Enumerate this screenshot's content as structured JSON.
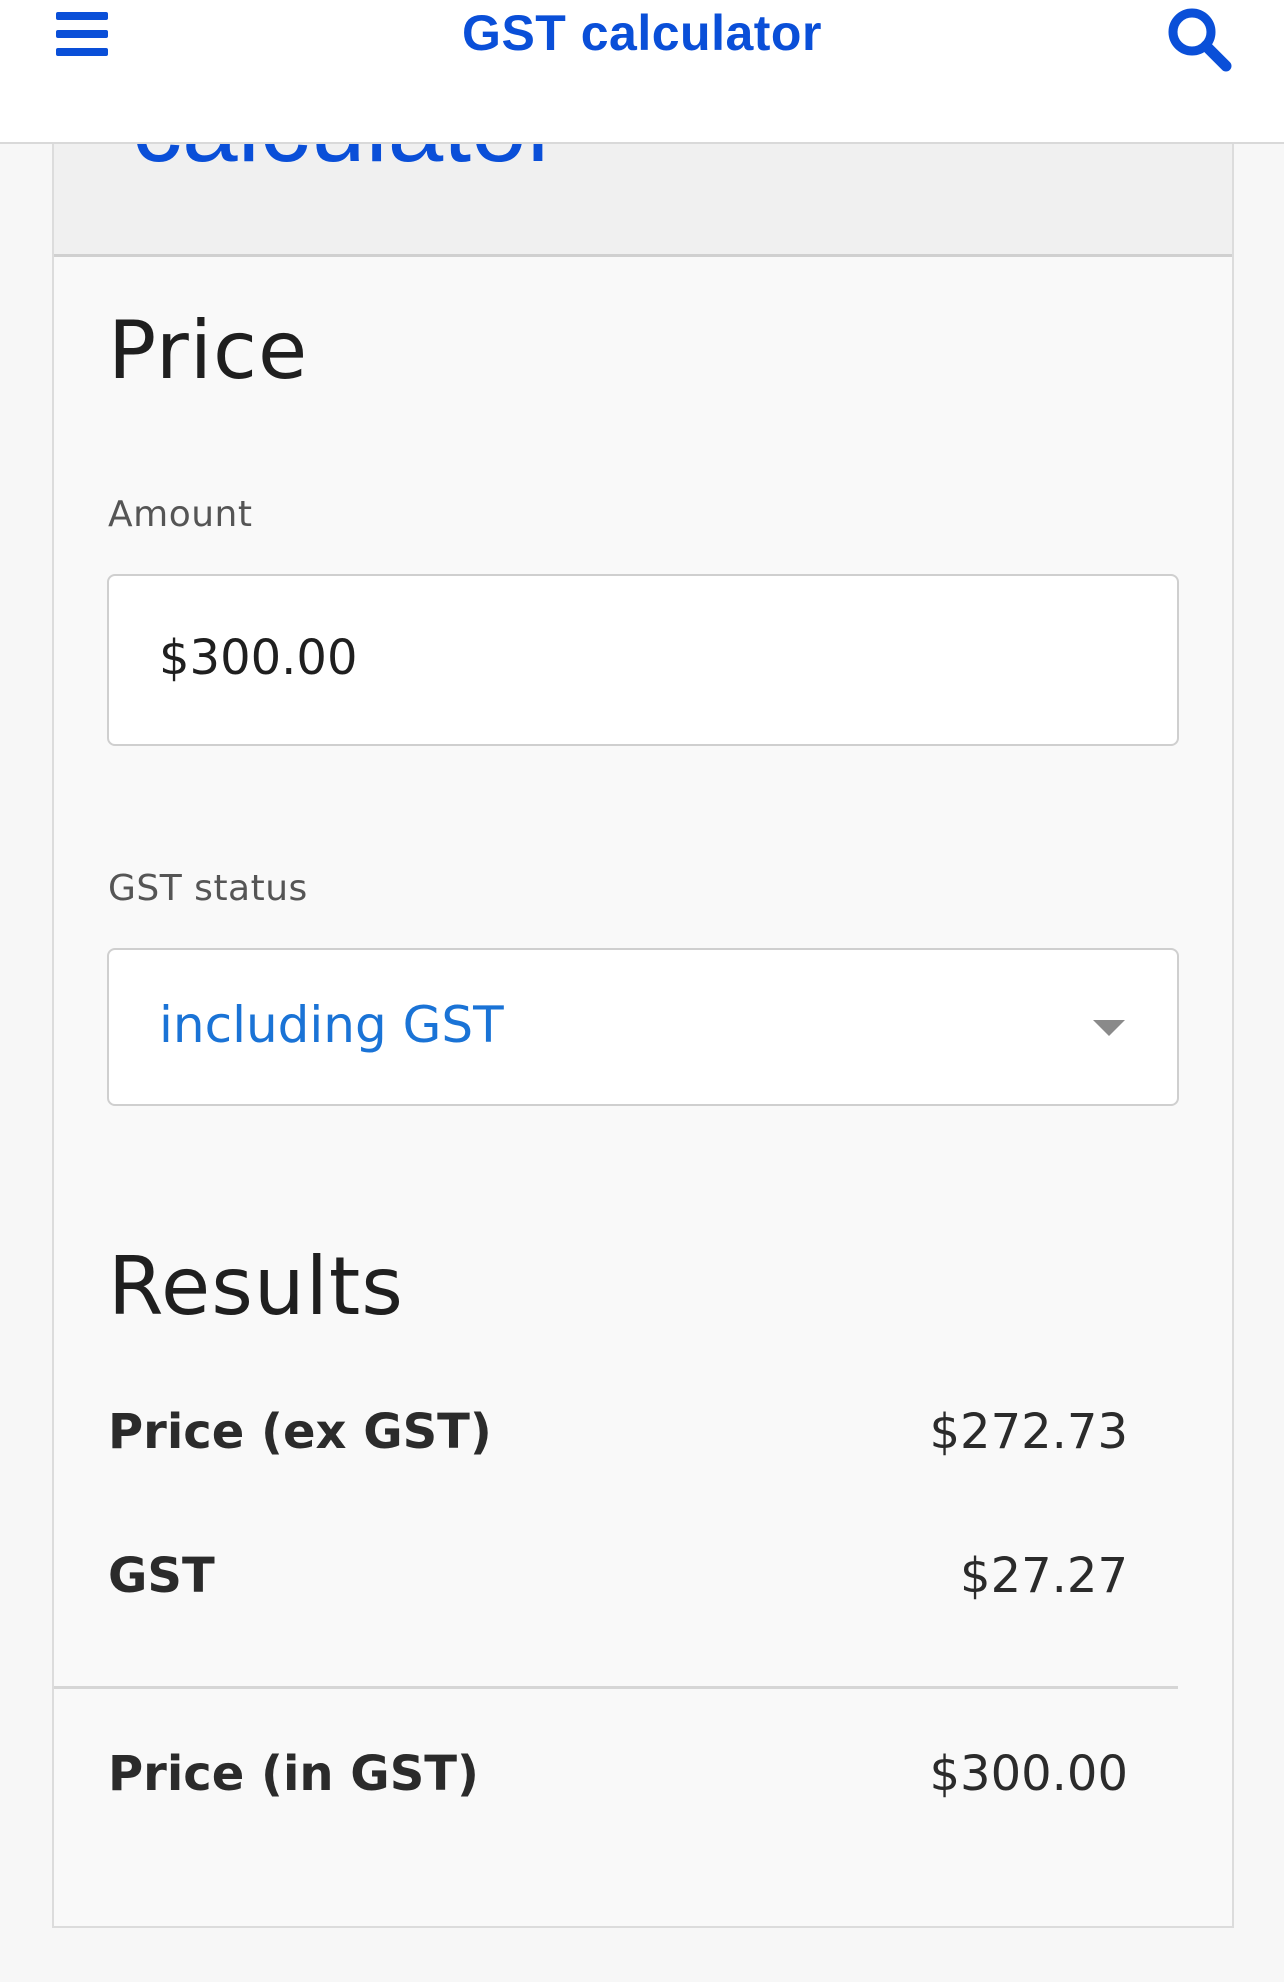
{
  "header": {
    "title": "GST calculator",
    "menu_icon": "hamburger-menu-icon",
    "search_icon": "search-icon",
    "accent_color": "#0a4fd8"
  },
  "card": {
    "header_title": "calculator"
  },
  "price": {
    "heading": "Price",
    "amount_label": "Amount",
    "amount_value": "$300.00",
    "gst_status_label": "GST status",
    "gst_status_selected": "including GST"
  },
  "results": {
    "heading": "Results",
    "rows": [
      {
        "label": "Price (ex GST)",
        "value": "$272.73"
      },
      {
        "label": "GST",
        "value": "$27.27"
      }
    ],
    "total": {
      "label": "Price (in GST)",
      "value": "$300.00"
    }
  }
}
